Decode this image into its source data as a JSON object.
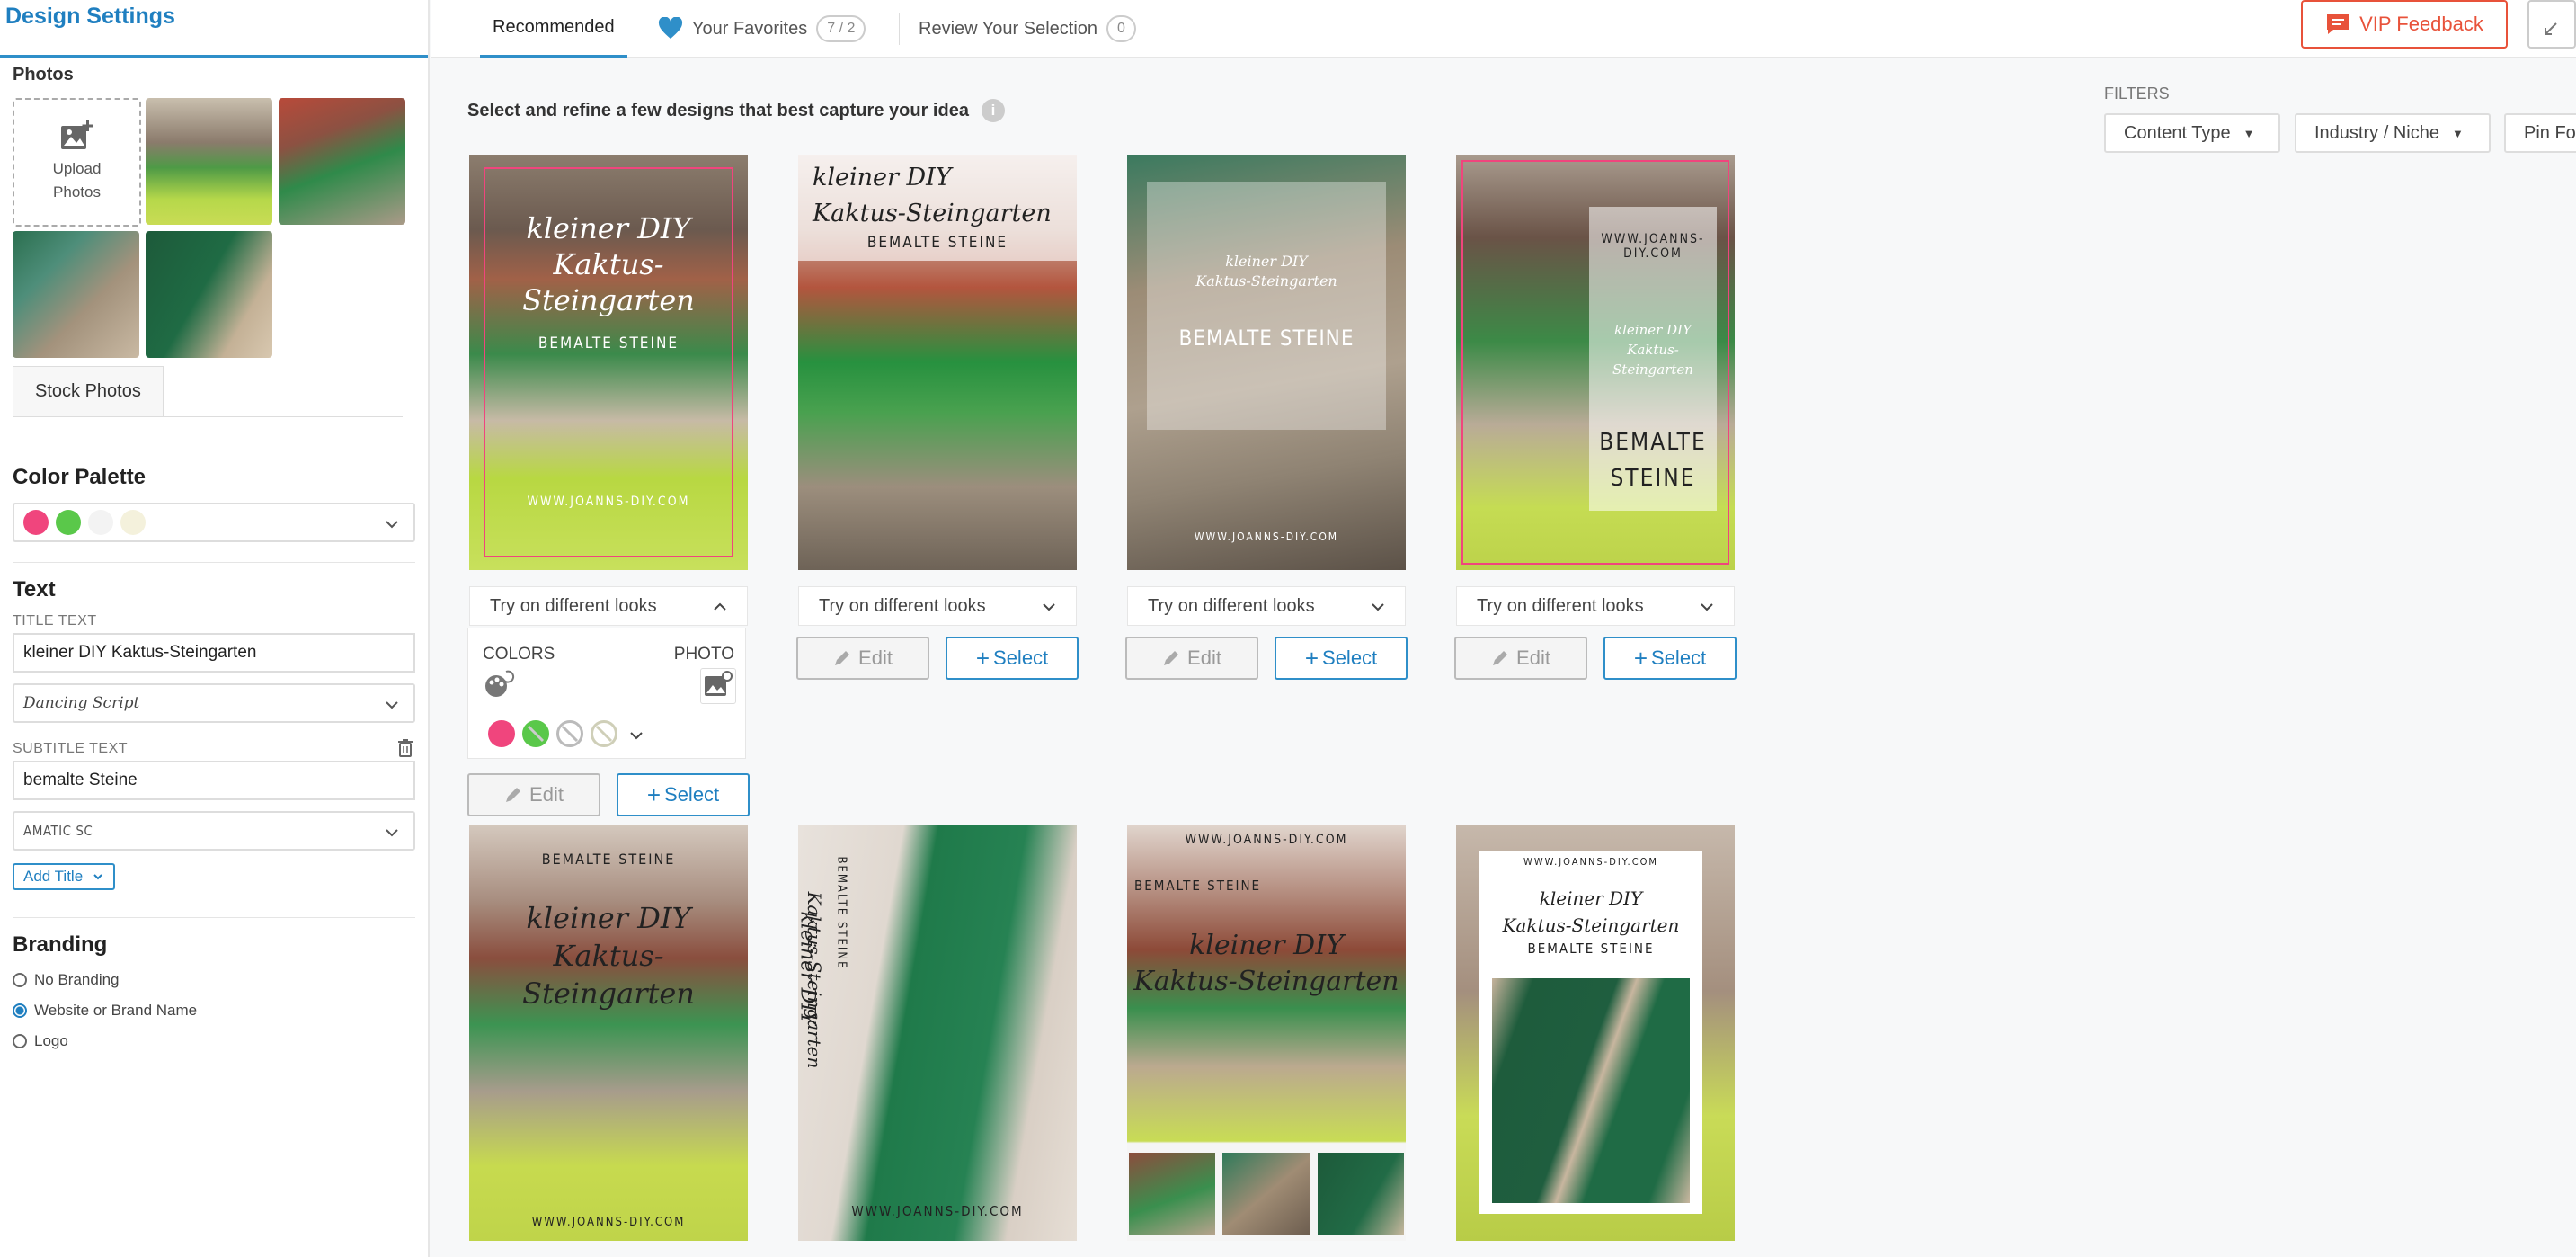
{
  "sidebar": {
    "title": "Design Settings",
    "photos_label": "Photos",
    "upload_label_line1": "Upload",
    "upload_label_line2": "Photos",
    "stock_photos_tab": "Stock Photos",
    "color_palette_label": "Color Palette",
    "palette_colors": [
      "#f0457d",
      "#5ac84a",
      "#f3f3f3",
      "#f4f1dc"
    ],
    "text_label": "Text",
    "title_text_label": "TITLE TEXT",
    "title_text_value": "kleiner DIY Kaktus-Steingarten",
    "title_font": "Dancing Script",
    "subtitle_text_label": "SUBTITLE TEXT",
    "subtitle_text_value": "bemalte Steine",
    "subtitle_font": "AMATIC SC",
    "add_title_label": "Add Title",
    "branding_label": "Branding",
    "branding_options": [
      {
        "label": "No Branding",
        "selected": false
      },
      {
        "label": "Website or Brand Name",
        "selected": true
      },
      {
        "label": "Logo",
        "selected": false
      }
    ]
  },
  "topnav": {
    "tabs": [
      {
        "label": "Recommended",
        "active": true
      },
      {
        "label": "Your Favorites",
        "count": "7 / 2"
      },
      {
        "label": "Review Your Selection",
        "count": "0"
      }
    ],
    "vip_feedback": "VIP Feedback"
  },
  "main": {
    "instruction": "Select and refine a few designs that best capture your idea",
    "filters_label": "FILTERS",
    "filters": [
      "Content Type",
      "Industry / Niche",
      "Pin Fo"
    ],
    "try_looks_label": "Try on different looks",
    "edit_label": "Edit",
    "select_label": "Select",
    "colors_label": "COLORS",
    "photo_label": "PHOTO",
    "look_colors": [
      "#f0457d",
      "#5ac84a"
    ],
    "pins": [
      {
        "title_line1": "kleiner DIY",
        "title_line2": "Kaktus-Steingarten",
        "subtitle": "BEMALTE STEINE",
        "url": "WWW.JOANNS-DIY.COM"
      },
      {
        "title_line1": "kleiner DIY",
        "title_line2": "Kaktus-Steingarten",
        "subtitle": "BEMALTE STEINE",
        "url": ""
      },
      {
        "title_line1": "kleiner DIY",
        "title_line2": "Kaktus-Steingarten",
        "subtitle": "BEMALTE STEINE",
        "url": "WWW.JOANNS-DIY.COM"
      },
      {
        "title_line1": "kleiner DIY",
        "title_line2": "Kaktus-Steingarten",
        "subtitle_line1": "BEMALTE",
        "subtitle_line2": "STEINE",
        "url": "WWW.JOANNS-DIY.COM"
      },
      {
        "title_line1": "kleiner DIY",
        "title_line2": "Kaktus-Steingarten",
        "subtitle": "BEMALTE STEINE",
        "url": "WWW.JOANNS-DIY.COM"
      },
      {
        "title_line1": "kleiner DIY",
        "title_line2": "Kaktus-Steingarten",
        "subtitle": "BEMALTE STEINE",
        "url": "WWW.JOANNS-DIY.COM"
      },
      {
        "title_line1": "kleiner DIY",
        "title_line2": "Kaktus-Steingarten",
        "subtitle": "BEMALTE STEINE",
        "url": "WWW.JOANNS-DIY.COM"
      },
      {
        "title_line1": "kleiner DIY",
        "title_line2": "Kaktus-Steingarten",
        "subtitle": "BEMALTE STEINE",
        "url": "WWW.JOANNS-DIY.COM"
      }
    ]
  },
  "icons": {
    "upload": "add-photo-icon",
    "heart": "heart-icon",
    "vip": "chat-icon",
    "info": "info-icon",
    "trash": "trash-icon",
    "pencil": "pencil-icon",
    "chevron": "chevron-down-icon"
  }
}
